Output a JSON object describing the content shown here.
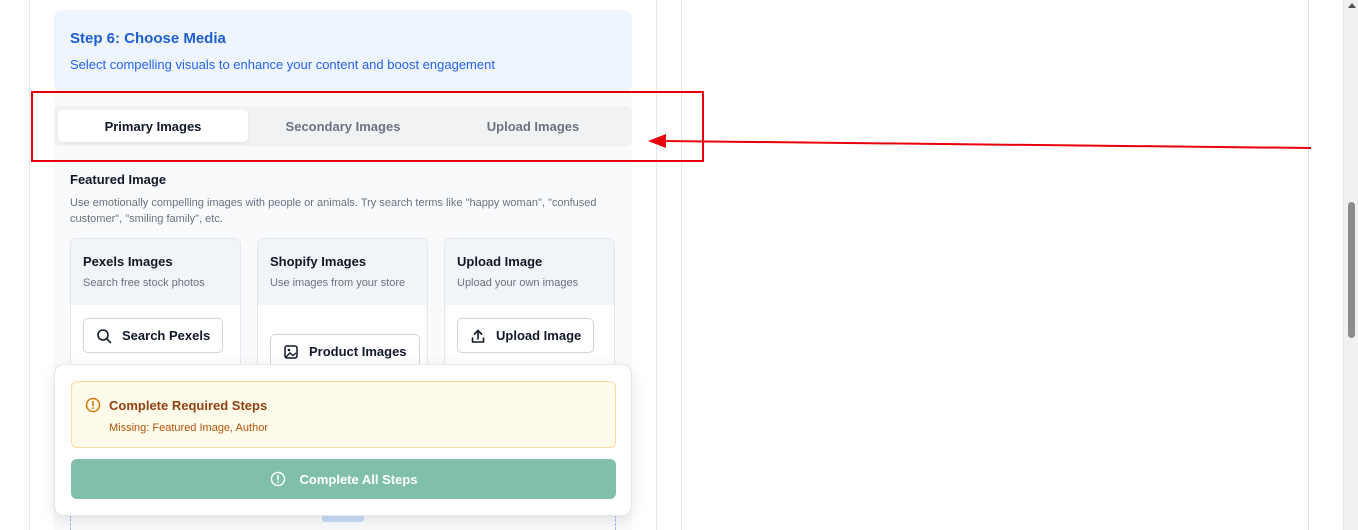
{
  "step": {
    "title": "Step 6: Choose Media",
    "subtitle": "Select compelling visuals to enhance your content and boost engagement"
  },
  "tabs": [
    {
      "label": "Primary Images",
      "active": true
    },
    {
      "label": "Secondary Images",
      "active": false
    },
    {
      "label": "Upload Images",
      "active": false
    }
  ],
  "featured": {
    "title": "Featured Image",
    "description": "Use emotionally compelling images with people or animals. Try search terms like \"happy woman\", \"confused customer\", \"smiling family\", etc."
  },
  "cards": [
    {
      "title": "Pexels Images",
      "subtitle": "Search free stock photos",
      "button": "Search Pexels",
      "icon": "search-icon"
    },
    {
      "title": "Shopify Images",
      "subtitle": "Use images from your store",
      "button": "Product Images",
      "icon": "image-icon"
    },
    {
      "title": "Upload Image",
      "subtitle": "Upload your own images",
      "button": "Upload Image",
      "icon": "upload-icon"
    }
  ],
  "footer": {
    "warning_title": "Complete Required Steps",
    "warning_message": "Missing: Featured Image, Author",
    "button_label": "Complete All Steps"
  },
  "colors": {
    "annotation": "#e8000d",
    "accent": "#1d5fd2",
    "complete_button": "#80bfa9",
    "warning_bg": "#fffbeb"
  }
}
